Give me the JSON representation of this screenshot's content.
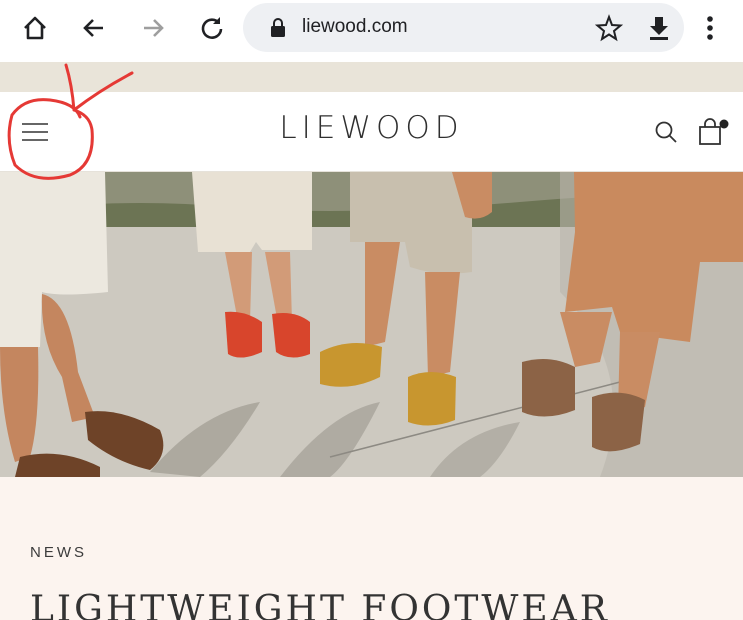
{
  "browser": {
    "url": "liewood.com",
    "icons": [
      "home-icon",
      "back-icon",
      "forward-icon",
      "reload-icon",
      "lock-icon",
      "star-icon",
      "download-icon",
      "more-icon"
    ]
  },
  "site": {
    "logo": "LIEWOOD",
    "header_icons": [
      "hamburger-menu-icon",
      "search-icon",
      "cart-icon"
    ]
  },
  "news": {
    "eyebrow": "NEWS",
    "headline": "LIGHTWEIGHT FOOTWEAR"
  },
  "colors": {
    "banner": "#e9e4d9",
    "news_background": "#fcf4ef",
    "annotation_red": "#e53935"
  }
}
